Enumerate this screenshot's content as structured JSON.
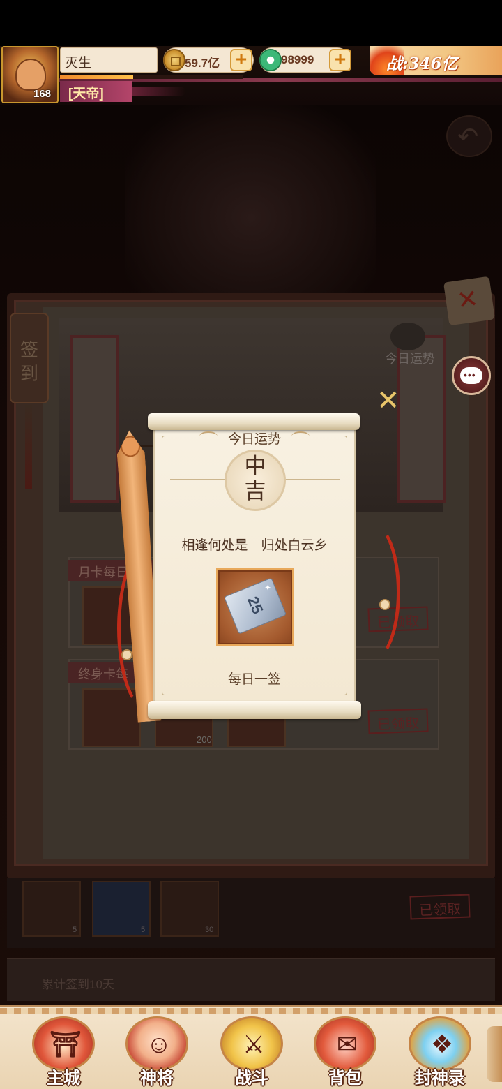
{
  "player": {
    "name": "灭生",
    "level": "168",
    "title": "[天帝]",
    "xp_progress": 0.4
  },
  "resources": {
    "gold": "59.7亿",
    "jade": "98999"
  },
  "power": "战:346亿",
  "signin_panel": {
    "side_tab": "签到",
    "fortune_label": "今日运势",
    "rows": [
      {
        "label": "月卡每日",
        "status": "已领取"
      },
      {
        "label": "终身卡每",
        "status": "已领取",
        "item_count": "200"
      }
    ],
    "bottom_row_status": "已领取",
    "bottom_row_counts": [
      "5",
      "5",
      "30"
    ],
    "accumulate_text": "累计签到10天"
  },
  "fortune_popup": {
    "title": "今日运势",
    "lot": "中吉",
    "poem": "相逢何处是　归处白云乡",
    "reward_item": "ticket-25",
    "reward_label": "25",
    "footer": "每日一签"
  },
  "nav": {
    "items": [
      {
        "label": "主城",
        "icon": "city-gate-icon"
      },
      {
        "label": "神将",
        "icon": "hero-portrait-icon"
      },
      {
        "label": "战斗",
        "icon": "crossed-swords-icon"
      },
      {
        "label": "背包",
        "icon": "backpack-icon"
      },
      {
        "label": "封神录",
        "icon": "scroll-record-icon"
      }
    ]
  },
  "colors": {
    "accent_red": "#c02a18",
    "paper": "#f3e8d2",
    "gold": "#c88d2a"
  }
}
